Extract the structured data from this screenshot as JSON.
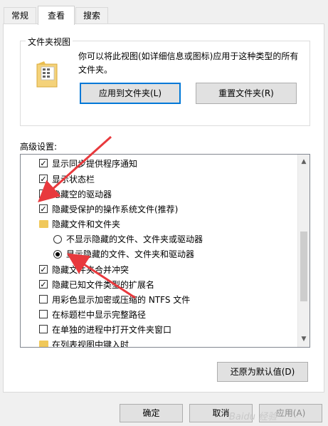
{
  "tabs": [
    {
      "label": "常规"
    },
    {
      "label": "查看"
    },
    {
      "label": "搜索"
    }
  ],
  "folder_views": {
    "group_label": "文件夹视图",
    "description": "你可以将此视图(如详细信息或图标)应用于这种类型的所有文件夹。",
    "apply_button": "应用到文件夹(L)",
    "reset_button": "重置文件夹(R)"
  },
  "advanced": {
    "label": "高级设置:",
    "items": [
      {
        "type": "checkbox",
        "checked": true,
        "label": "显示同步提供程序通知"
      },
      {
        "type": "checkbox",
        "checked": true,
        "label": "显示状态栏"
      },
      {
        "type": "checkbox",
        "checked": true,
        "label": "隐藏空的驱动器"
      },
      {
        "type": "checkbox",
        "checked": true,
        "label": "隐藏受保护的操作系统文件(推荐)"
      },
      {
        "type": "folder",
        "label": "隐藏文件和文件夹"
      },
      {
        "type": "radio",
        "checked": false,
        "label": "不显示隐藏的文件、文件夹或驱动器"
      },
      {
        "type": "radio",
        "checked": true,
        "label": "显示隐藏的文件、文件夹和驱动器"
      },
      {
        "type": "checkbox",
        "checked": true,
        "label": "隐藏文件夹合并冲突"
      },
      {
        "type": "checkbox",
        "checked": true,
        "label": "隐藏已知文件类型的扩展名"
      },
      {
        "type": "checkbox",
        "checked": false,
        "label": "用彩色显示加密或压缩的 NTFS 文件"
      },
      {
        "type": "checkbox",
        "checked": false,
        "label": "在标题栏中显示完整路径"
      },
      {
        "type": "checkbox",
        "checked": false,
        "label": "在单独的进程中打开文件夹窗口"
      },
      {
        "type": "folder",
        "label": "在列表视图中键入时"
      }
    ],
    "restore_button": "还原为默认值(D)"
  },
  "footer": {
    "ok": "确定",
    "cancel": "取消",
    "apply": "应用(A)"
  },
  "watermark": "Baidu 经验",
  "colors": {
    "accent": "#0078d7",
    "arrow": "#e8393d"
  }
}
